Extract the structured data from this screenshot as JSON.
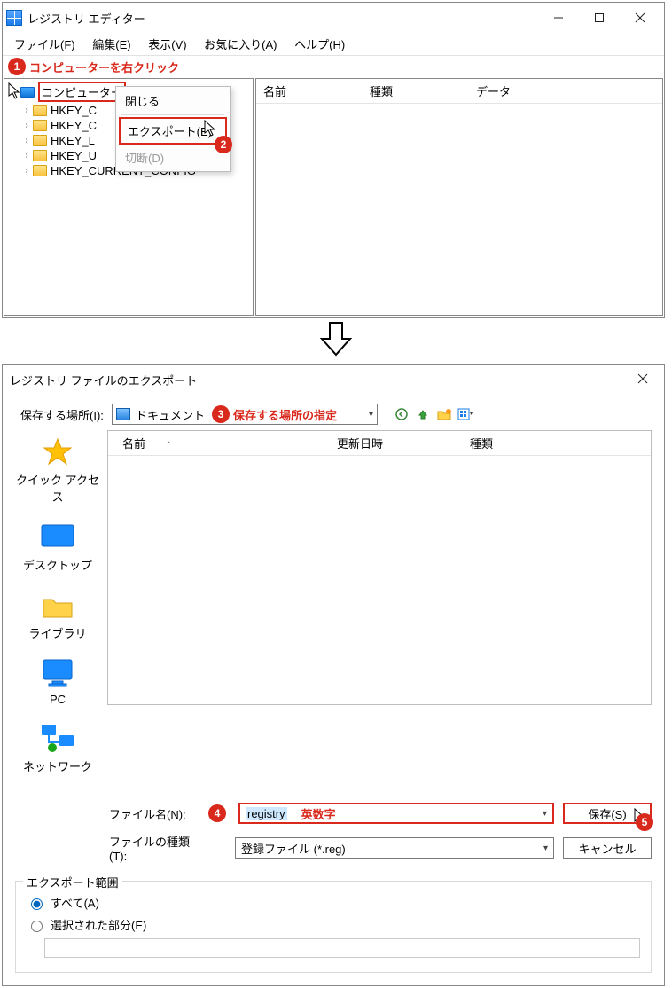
{
  "win1": {
    "title": "レジストリ エディター",
    "menu": {
      "file": "ファイル(F)",
      "edit": "編集(E)",
      "view": "表示(V)",
      "favorites": "お気に入り(A)",
      "help": "ヘルプ(H)"
    },
    "annot1": "コンピューターを右クリック",
    "tree": {
      "root": "コンピューター",
      "keys": [
        "HKEY_C",
        "HKEY_C",
        "HKEY_L",
        "HKEY_U",
        "HKEY_CURRENT_CONFIG"
      ]
    },
    "context": {
      "collapse": "閉じる",
      "export": "エクスポート(E)",
      "disconnect": "切断(D)"
    },
    "cols": {
      "name": "名前",
      "type": "種類",
      "data": "データ"
    }
  },
  "win2": {
    "title": "レジストリ ファイルのエクスポート",
    "saveloc_label": "保存する場所(I):",
    "saveloc_value": "ドキュメント",
    "annot3": "保存する場所の指定",
    "places": {
      "quick": "クイック アクセス",
      "desktop": "デスクトップ",
      "library": "ライブラリ",
      "pc": "PC",
      "network": "ネットワーク"
    },
    "cols": {
      "name": "名前",
      "date": "更新日時",
      "type": "種類"
    },
    "filename_label": "ファイル名(N):",
    "filename_value": "registry",
    "annot4": "英数字",
    "filetype_label": "ファイルの種類(T):",
    "filetype_value": "登録ファイル (*.reg)",
    "save_btn": "保存(S)",
    "cancel_btn": "キャンセル",
    "range": {
      "group": "エクスポート範囲",
      "all": "すべて(A)",
      "selected": "選択された部分(E)"
    }
  },
  "nums": {
    "n1": "1",
    "n2": "2",
    "n3": "3",
    "n4": "4",
    "n5": "5"
  }
}
